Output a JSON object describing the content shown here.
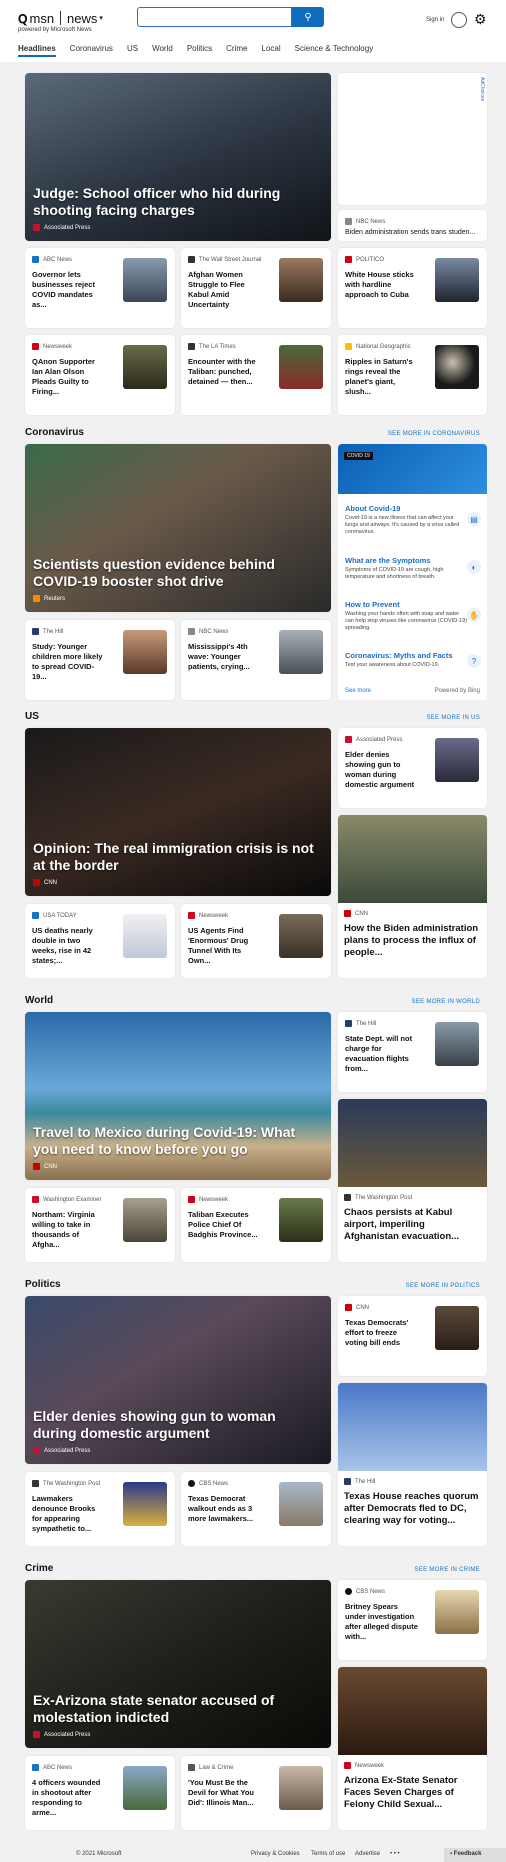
{
  "header": {
    "brand_small": "msn",
    "brand": "news",
    "powered": "powered by Microsoft News",
    "signin": "Sign in",
    "search_placeholder": ""
  },
  "nav": [
    "Headlines",
    "Coronavirus",
    "US",
    "World",
    "Politics",
    "Crime",
    "Local",
    "Science & Technology"
  ],
  "headlines": {
    "hero": {
      "title": "Judge: School officer who hid during shooting facing charges",
      "source": "Associated Press"
    },
    "ad_label": "AdChoices",
    "side1": {
      "source": "NBC News",
      "title": "Biden administration sends trans studen..."
    },
    "row1": [
      {
        "source": "ABC News",
        "title": "Governor lets businesses reject COVID mandates as..."
      },
      {
        "source": "The Wall Street Journal",
        "title": "Afghan Women Struggle to Flee Kabul Amid Uncertainty"
      },
      {
        "source": "POLITICO",
        "title": "White House sticks with hardline approach to Cuba"
      }
    ],
    "row2": [
      {
        "source": "Newsweek",
        "title": "QAnon Supporter Ian Alan Olson Pleads Guilty to Firing..."
      },
      {
        "source": "The LA Times",
        "title": "Encounter with the Taliban: punched, detained — then..."
      },
      {
        "source": "National Geographic",
        "title": "Ripples in Saturn's rings reveal the planet's giant, slush..."
      }
    ]
  },
  "coronavirus": {
    "heading": "Coronavirus",
    "more": "SEE MORE IN CORONAVIRUS",
    "hero": {
      "title": "Scientists question evidence behind COVID-19 booster shot drive",
      "source": "Reuters"
    },
    "row": [
      {
        "source": "The Hill",
        "title": "Study: Younger children more likely to spread COVID-19..."
      },
      {
        "source": "NBC News",
        "title": "Mississippi's 4th wave: Younger patients, crying..."
      }
    ],
    "panel": {
      "badge": "COVID 19",
      "items": [
        {
          "h": "About Covid-19",
          "d": "Covid-19 is a new illness that can affect your lungs and airways. It's caused by a virus called coronavirus."
        },
        {
          "h": "What are the Symptoms",
          "d": "Symptoms of COVID-19 are cough, high temperature and shortness of breath."
        },
        {
          "h": "How to Prevent",
          "d": "Washing your hands often with soap and water can help stop viruses like coronavirus (COVID-19) spreading."
        },
        {
          "h": "Coronavirus: Myths and Facts",
          "d": "Test your awareness about COVID-19."
        }
      ],
      "see_more": "See more",
      "powered": "Powered by Bing"
    }
  },
  "us": {
    "heading": "US",
    "more": "SEE MORE IN US",
    "hero": {
      "title": "Opinion: The real immigration crisis is not at the border",
      "source": "CNN"
    },
    "side1": {
      "source": "Associated Press",
      "title": "Elder denies showing gun to woman during domestic argument"
    },
    "tall": {
      "source": "CNN",
      "title": "How the Biden administration plans to process the influx of people..."
    },
    "row": [
      {
        "source": "USA TODAY",
        "title": "US deaths nearly double in two weeks, rise in 42 states;..."
      },
      {
        "source": "Newsweek",
        "title": "US Agents Find 'Enormous' Drug Tunnel With Its Own..."
      }
    ]
  },
  "world": {
    "heading": "World",
    "more": "SEE MORE IN WORLD",
    "hero": {
      "title": "Travel to Mexico during Covid-19: What you need to know before you go",
      "source": "CNN"
    },
    "side1": {
      "source": "The Hill",
      "title": "State Dept. will not charge for evacuation flights from..."
    },
    "tall": {
      "source": "The Washington Post",
      "title": "Chaos persists at Kabul airport, imperiling Afghanistan evacuation..."
    },
    "row": [
      {
        "source": "Washington Examiner",
        "title": "Northam: Virginia willing to take in thousands of Afgha..."
      },
      {
        "source": "Newsweek",
        "title": "Taliban Executes Police Chief Of Badghis Province..."
      }
    ]
  },
  "politics": {
    "heading": "Politics",
    "more": "SEE MORE IN POLITICS",
    "hero": {
      "title": "Elder denies showing gun to woman during domestic argument",
      "source": "Associated Press"
    },
    "side1": {
      "source": "CNN",
      "title": "Texas Democrats' effort to freeze voting bill ends"
    },
    "tall": {
      "source": "The Hill",
      "title": "Texas House reaches quorum after Democrats fled to DC, clearing way for voting..."
    },
    "row": [
      {
        "source": "The Washington Post",
        "title": "Lawmakers denounce Brooks for appearing sympathetic to..."
      },
      {
        "source": "CBS News",
        "title": "Texas Democrat walkout ends as 3 more lawmakers..."
      }
    ]
  },
  "crime": {
    "heading": "Crime",
    "more": "SEE MORE IN CRIME",
    "hero": {
      "title": "Ex-Arizona state senator accused of molestation indicted",
      "source": "Associated Press"
    },
    "side1": {
      "source": "CBS News",
      "title": "Britney Spears under investigation after alleged dispute with..."
    },
    "tall": {
      "source": "Newsweek",
      "title": "Arizona Ex-State Senator Faces Seven Charges of Felony Child Sexual..."
    },
    "row": [
      {
        "source": "ABC News",
        "title": "4 officers wounded in shootout after responding to arme..."
      },
      {
        "source": "Law & Crime",
        "title": "'You Must Be the Devil for What You Did': Illinois Man..."
      }
    ]
  },
  "footer": {
    "copyright": "© 2021 Microsoft",
    "privacy": "Privacy & Cookies",
    "terms": "Terms of use",
    "advertise": "Advertise",
    "more": "• • •",
    "feedback": "Feedback"
  }
}
